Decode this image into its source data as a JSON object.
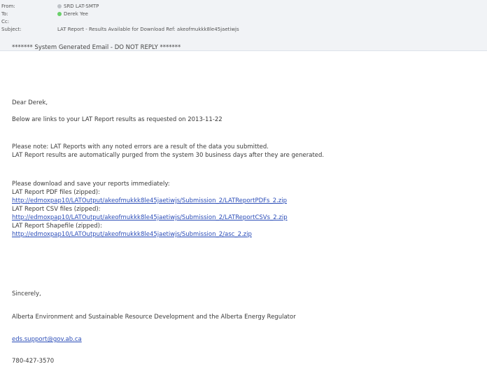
{
  "header": {
    "from_label": "From:",
    "from_value": "SRD LAT-SMTP",
    "to_label": "To:",
    "to_value": "Derek Yee",
    "cc_label": "Cc:",
    "subject_label": "Subject:",
    "subject_value": "LAT Report - Results Available for Download  Ref: akeofmukkk8le45jaetiwjs"
  },
  "email": {
    "system_notice": "******* System Generated Email - DO NOT REPLY *******",
    "greeting": "Dear Derek,",
    "intro": "Below are links to your LAT Report results as requested on 2013-11-22",
    "note_line1": "Please note: LAT Reports with any noted errors are a result of the data you submitted.",
    "note_line2": "LAT Report results are automatically purged from the system 30 business days after they are generated.",
    "download_instruction": "Please download and save your reports immediately:",
    "files": [
      {
        "label": "LAT Report PDF files (zipped):",
        "url": "http://edmoxpap10/LATOutput/akeofmukkk8le45jaetiwjs/Submission_2/LATReportPDFs_2.zip"
      },
      {
        "label": "LAT Report CSV files (zipped):",
        "url": "http://edmoxpap10/LATOutput/akeofmukkk8le45jaetiwjs/Submission_2/LATReportCSVs_2.zip"
      },
      {
        "label": "LAT Report Shapefile (zipped):",
        "url": "http://edmoxpap10/LATOutput/akeofmukkk8le45jaetiwjs/Submission_2/asc_2.zip"
      }
    ],
    "closing": "Sincerely,",
    "signature_org": "Alberta Environment and Sustainable Resource Development and the Alberta Energy Regulator",
    "support_email": "eds.support@gov.ab.ca",
    "phone": "780-427-3570"
  },
  "colors": {
    "link": "#2b4db8",
    "header_bg": "#f1f3f6",
    "status_online": "#6ad06a"
  }
}
